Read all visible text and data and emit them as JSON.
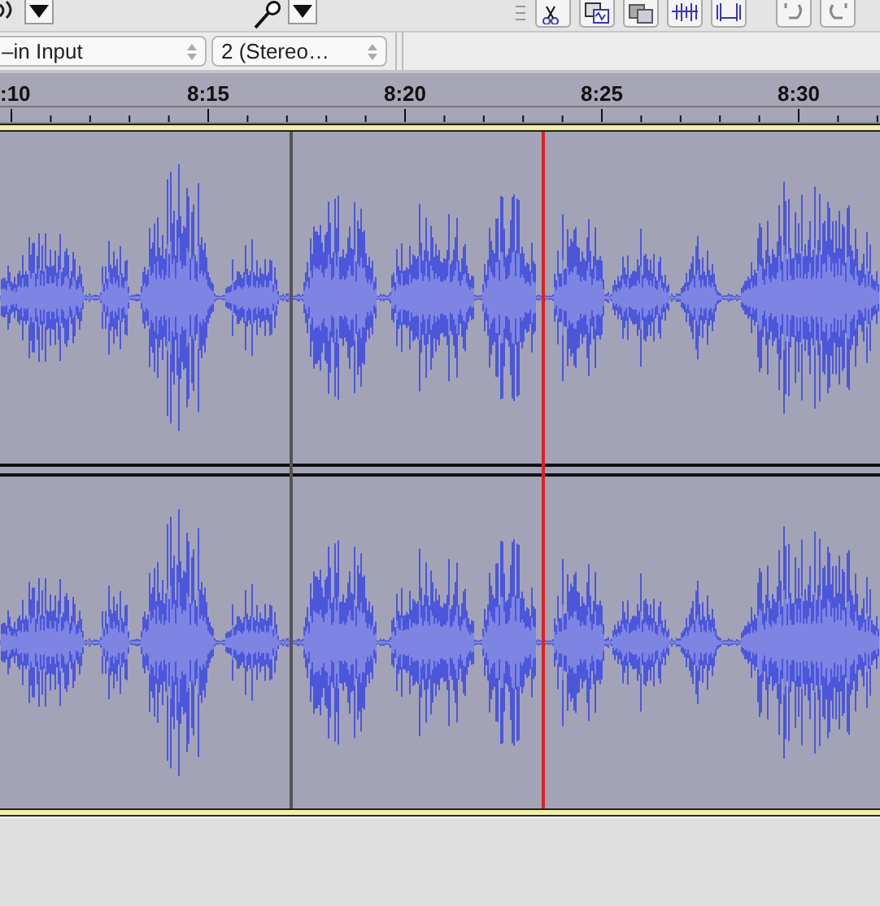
{
  "device_bar": {
    "input_source": "–in Input",
    "channels": "2 (Stereo…"
  },
  "ruler": {
    "labels": [
      ":10",
      "8:15",
      "8:20",
      "8:25",
      "8:30"
    ]
  },
  "tracks": [
    {
      "kind": "audio"
    },
    {
      "kind": "audio"
    }
  ]
}
